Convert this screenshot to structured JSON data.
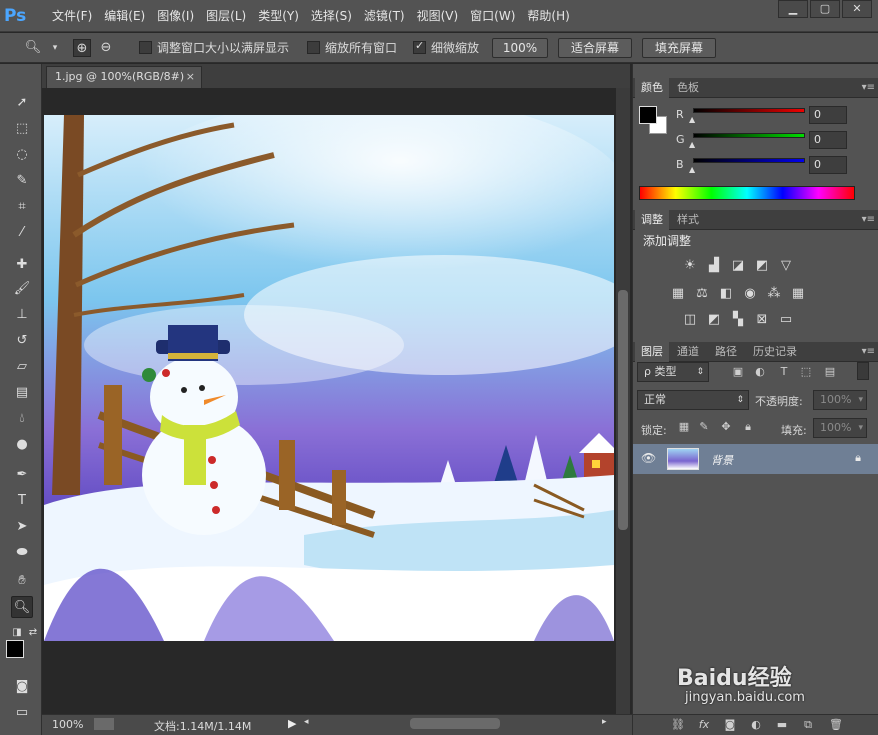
{
  "app": {
    "logo": "Ps"
  },
  "menu": [
    "文件(F)",
    "编辑(E)",
    "图像(I)",
    "图层(L)",
    "类型(Y)",
    "选择(S)",
    "滤镜(T)",
    "视图(V)",
    "窗口(W)",
    "帮助(H)"
  ],
  "window_controls": {
    "minimize": "▁",
    "restore": "▢",
    "close": "✕"
  },
  "options": {
    "resize_windows_label": "调整窗口大小以满屏显示",
    "resize_windows_checked": false,
    "zoom_all_label": "缩放所有窗口",
    "zoom_all_checked": false,
    "scrubby_label": "细微缩放",
    "scrubby_checked": true,
    "btn_100": "100%",
    "btn_fit": "适合屏幕",
    "btn_fill": "填充屏幕"
  },
  "document": {
    "tab_title": "1.jpg @ 100%(RGB/8#)",
    "close": "×"
  },
  "status": {
    "zoom": "100%",
    "doc_info": "文档:1.14M/1.14M"
  },
  "color_panel": {
    "tabs": [
      "颜色",
      "色板"
    ],
    "r_label": "R",
    "g_label": "G",
    "b_label": "B",
    "r_value": "0",
    "g_value": "0",
    "b_value": "0"
  },
  "adjust_panel": {
    "tabs": [
      "调整",
      "样式"
    ],
    "heading": "添加调整"
  },
  "layers_panel": {
    "tabs": [
      "图层",
      "通道",
      "路径",
      "历史记录"
    ],
    "filter_label": "ρ 类型",
    "blend_mode": "正常",
    "opacity_label": "不透明度:",
    "opacity_value": "100%",
    "lock_label": "锁定:",
    "fill_label": "填充:",
    "fill_value": "100%",
    "layers": [
      {
        "name": "背景",
        "visible": true,
        "locked": true
      }
    ]
  },
  "watermark": {
    "brand": "Baidu经验",
    "url": "jingyan.baidu.com"
  }
}
